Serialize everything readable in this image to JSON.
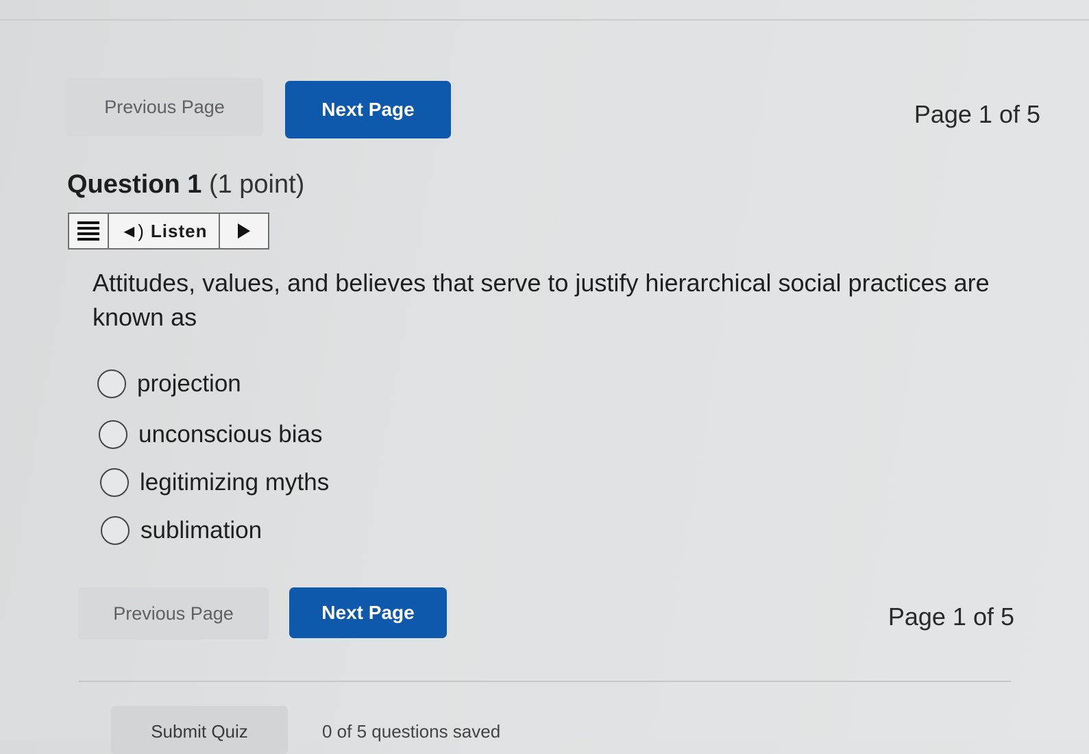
{
  "navigation": {
    "previous_label": "Previous Page",
    "next_label": "Next Page",
    "page_indicator": "Page 1 of 5"
  },
  "question": {
    "number_label": "Question 1",
    "points_label": "(1 point)",
    "text": "Attitudes, values, and believes that serve to justify hierarchical social practices are known as"
  },
  "listen": {
    "menu_icon": "hamburger-menu-icon",
    "speaker_icon": "speaker-icon",
    "label": "Listen",
    "play_icon": "play-icon"
  },
  "options": [
    {
      "label": "projection"
    },
    {
      "label": "unconscious bias"
    },
    {
      "label": "legitimizing myths"
    },
    {
      "label": "sublimation"
    }
  ],
  "footer": {
    "submit_label": "Submit Quiz",
    "answered_status": "0 of 5 questions saved"
  },
  "colors": {
    "next_button": "#0f59ad",
    "previous_button": "#d6d8d9",
    "background": "#dfe1e2"
  }
}
